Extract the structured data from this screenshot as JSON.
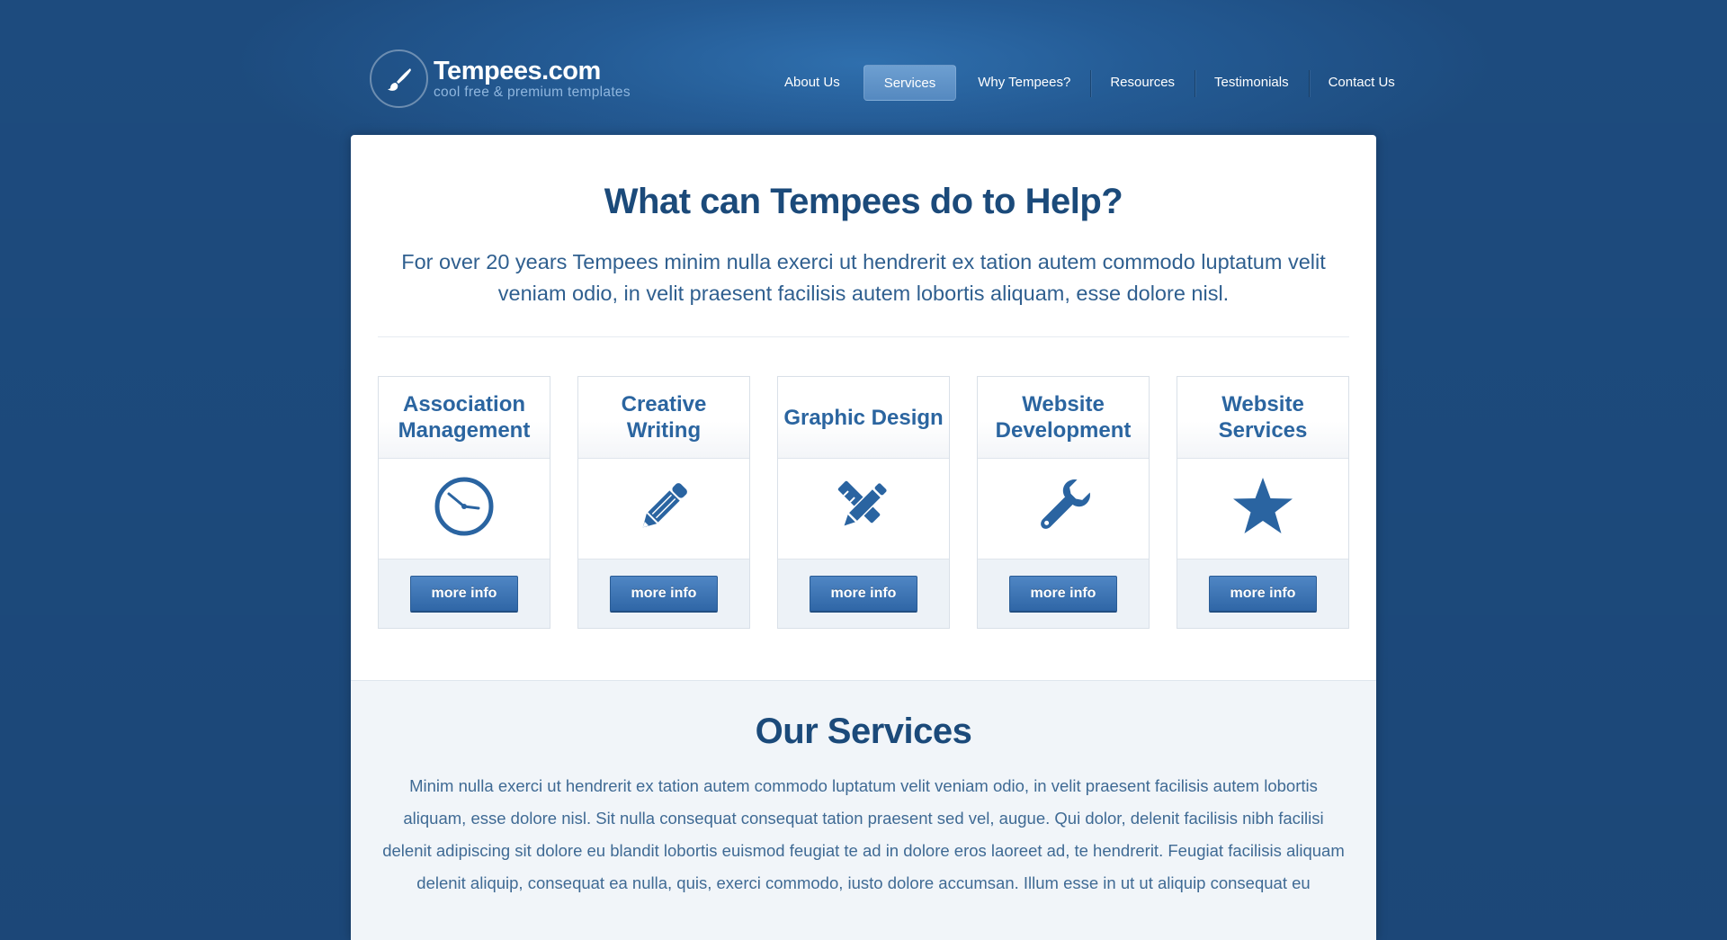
{
  "header": {
    "logo": {
      "name": "Tempees.com",
      "tagline": "cool free & premium templates",
      "icon": "paintbrush-icon"
    },
    "nav": [
      {
        "label": "About Us",
        "active": false
      },
      {
        "label": "Services",
        "active": true
      },
      {
        "label": "Why Tempees?",
        "active": false
      },
      {
        "label": "Resources",
        "active": false
      },
      {
        "label": "Testimonials",
        "active": false
      },
      {
        "label": "Contact Us",
        "active": false
      }
    ]
  },
  "help": {
    "title": "What can Tempees do to Help?",
    "text": "For over 20 years Tempees minim nulla exerci ut hendrerit ex tation autem commodo luptatum velit veniam odio, in velit praesent facilisis autem lobortis aliquam, esse dolore nisl."
  },
  "cards": [
    {
      "title": "Association Management",
      "icon": "clock-icon",
      "button": "more info"
    },
    {
      "title": "Creative Writing",
      "icon": "pencil-icon",
      "button": "more info"
    },
    {
      "title": "Graphic Design",
      "icon": "pencil-ruler-icon",
      "button": "more info"
    },
    {
      "title": "Website Development",
      "icon": "wrench-icon",
      "button": "more info"
    },
    {
      "title": "Website Services",
      "icon": "star-icon",
      "button": "more info"
    }
  ],
  "services": {
    "title": "Our Services",
    "text": "Minim nulla exerci ut hendrerit ex tation autem commodo luptatum velit veniam odio, in velit praesent facilisis autem lobortis aliquam, esse dolore nisl. Sit nulla consequat consequat tation praesent sed vel, augue. Qui dolor, delenit facilisis nibh facilisi delenit adipiscing sit dolore eu blandit lobortis euismod feugiat te ad in dolore eros laoreet ad, te hendrerit. Feugiat facilisis aliquam delenit aliquip, consequat ea nulla, quis, exerci commodo, iusto dolore accumsan. Illum esse in ut ut aliquip consequat eu"
  },
  "colors": {
    "background": "#1d4b7e",
    "heading": "#1b4a7a",
    "accent": "#2b65a0",
    "button": "#3a72b2"
  }
}
